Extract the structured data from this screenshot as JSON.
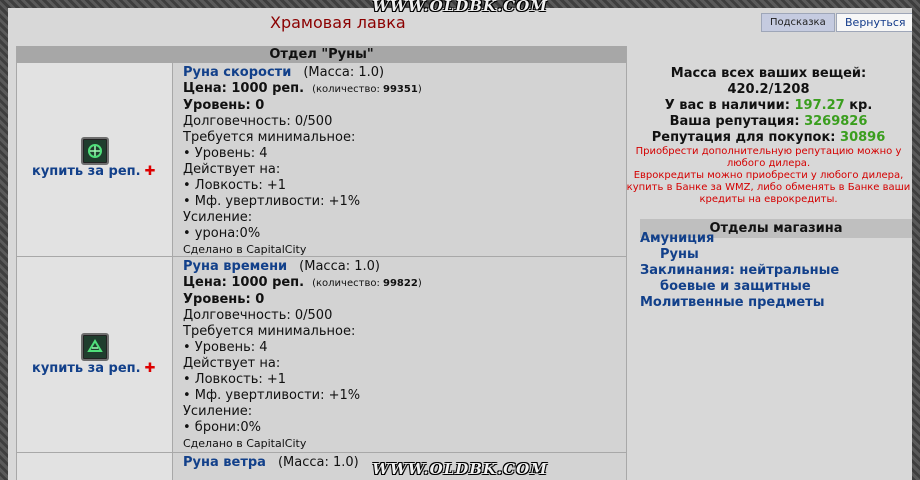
{
  "watermark": "WWW.OLDBK.COM",
  "header": {
    "title": "Храмовая лавка",
    "hint_label": "Подсказка",
    "back_label": "Вернуться"
  },
  "department": {
    "title": "Отдел \"Руны\""
  },
  "items": [
    {
      "name": "Руна скорости",
      "mass": "(Масса: 1.0)",
      "price": "Цена: 1000 реп.",
      "quantity_label": "(количество:",
      "quantity": "99351",
      "quantity_close": ")",
      "level": "Уровень: 0",
      "durability": "Долговечность: 0/500",
      "requires": "Требуется минимальное:",
      "req_level": "• Уровень: 4",
      "acts_on": "Действует на:",
      "effect1": "• Ловкость: +1",
      "effect2": "• Мф. увертливости: +1%",
      "boost": "Усиление:",
      "boost_value": "• урона:0%",
      "made_in": "Сделано в CapitalCity",
      "buy_label": "купить за реп.",
      "icon": "speed-rune-icon"
    },
    {
      "name": "Руна времени",
      "mass": "(Масса: 1.0)",
      "price": "Цена: 1000 реп.",
      "quantity_label": "(количество:",
      "quantity": "99822",
      "quantity_close": ")",
      "level": "Уровень: 0",
      "durability": "Долговечность: 0/500",
      "requires": "Требуется минимальное:",
      "req_level": "• Уровень: 4",
      "acts_on": "Действует на:",
      "effect1": "• Ловкость: +1",
      "effect2": "• Мф. увертливости: +1%",
      "boost": "Усиление:",
      "boost_value": "• брони:0%",
      "made_in": "Сделано в CapitalCity",
      "buy_label": "купить за реп.",
      "icon": "time-rune-icon"
    },
    {
      "name": "Руна ветра",
      "mass": "(Масса: 1.0)"
    }
  ],
  "sidebar": {
    "mass_label": "Масса всех ваших вещей:",
    "mass_value": "420.2/1208",
    "money_label": "У вас в наличии:",
    "money_value": "197.27",
    "money_unit": "кр.",
    "rep_label": "Ваша репутация:",
    "rep_value": "3269826",
    "buy_rep_label": "Репутация для покупок:",
    "buy_rep_value": "30896",
    "note1": "Приобрести дополнительную репутацию можно у любого дилера.",
    "note2": "Еврокредиты можно приобрести у любого дилера, купить в Банке за WMZ, либо обменять в Банке ваши кредиты на еврокредиты.",
    "shop_sections_title": "Отделы магазина",
    "categories": [
      "Амуниция",
      "Руны",
      "Заклинания: нейтральные",
      "боевые и защитные",
      "Молитвенные предметы"
    ]
  },
  "colors": {
    "title": "#8b0000",
    "link": "#12408a",
    "green": "#3a9e1e",
    "red": "#d40000"
  }
}
